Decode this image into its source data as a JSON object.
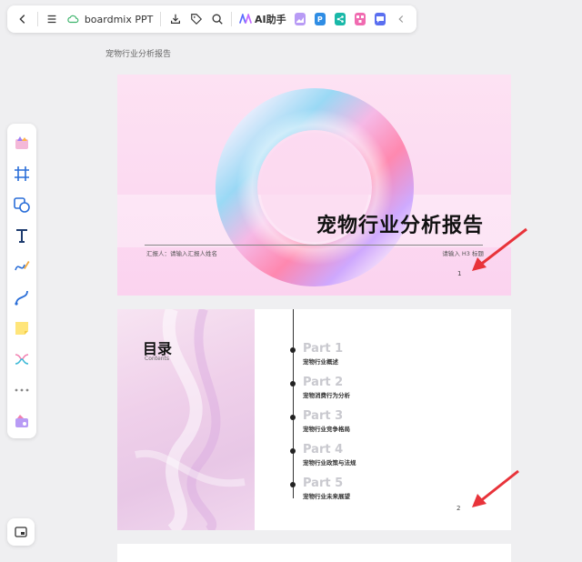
{
  "toolbar": {
    "doc_name": "boardmix PPT",
    "ai_label": "AI助手"
  },
  "breadcrumb": "宠物行业分析报告",
  "slide1": {
    "title": "宠物行业分析报告",
    "reporter": "汇报人：请输入汇报人姓名",
    "subtitle_placeholder": "请输入 H3 标题",
    "page": "1"
  },
  "slide2": {
    "title": "目录",
    "subtitle": "Contents",
    "parts": [
      {
        "num": "Part 1",
        "text": "宠物行业概述"
      },
      {
        "num": "Part 2",
        "text": "宠物消费行为分析"
      },
      {
        "num": "Part 3",
        "text": "宠物行业竞争格局"
      },
      {
        "num": "Part 4",
        "text": "宠物行业政策与法规"
      },
      {
        "num": "Part 5",
        "text": "宠物行业未来展望"
      }
    ],
    "page": "2"
  },
  "colors": {
    "accent_red": "#e8333a",
    "slide1_bg": "#fbd3ef"
  }
}
